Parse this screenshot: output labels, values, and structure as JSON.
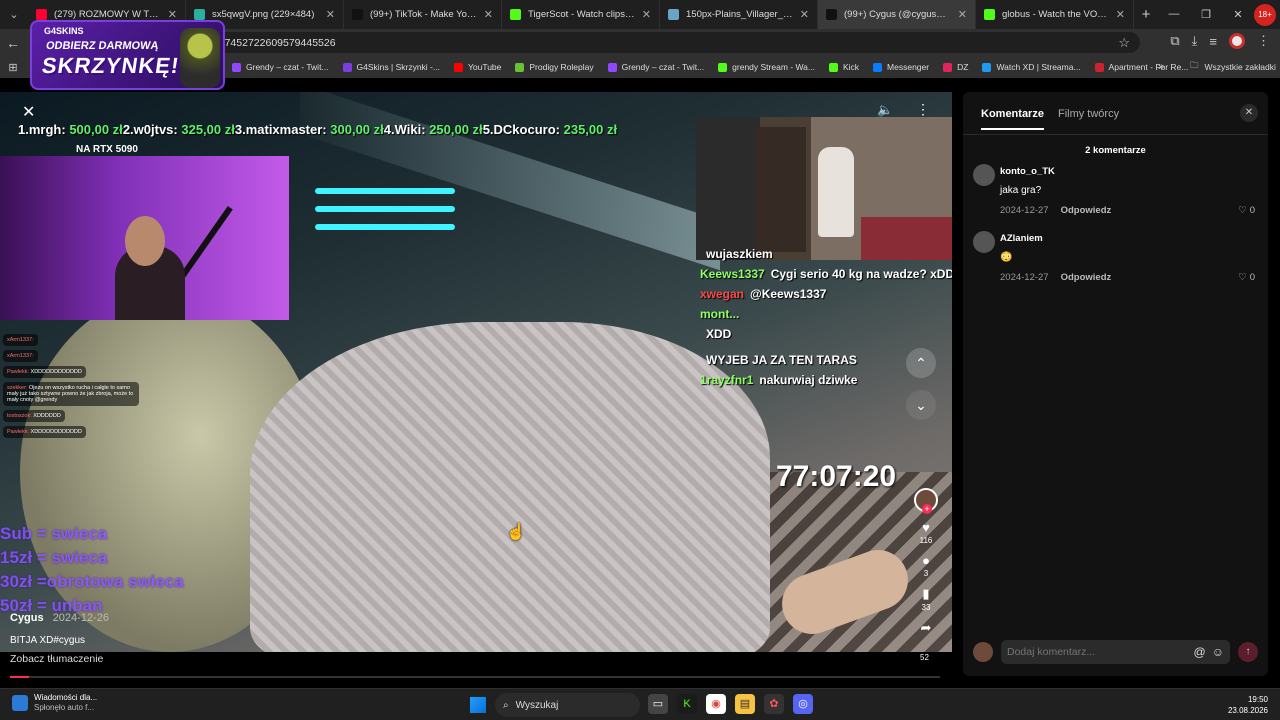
{
  "tabs": [
    {
      "title": "(279) ROZMOWY W TOKU ODCINEK",
      "color": "#ff0033"
    },
    {
      "title": "sx5qwgV.png (229×484)",
      "color": "#2bb0a0"
    },
    {
      "title": "(99+) TikTok - Make Your Day",
      "color": "#111111"
    },
    {
      "title": "TigerScot - Watch clips on Kick",
      "color": "#53fc18"
    },
    {
      "title": "150px-Plains_Villager_Base_JE2",
      "color": "#6aa3c8"
    },
    {
      "title": "(99+) Cygus (@cygus05) | TikTok",
      "color": "#111111",
      "active": true
    },
    {
      "title": "globus - Watch the VOD on Kick",
      "color": "#53fc18"
    }
  ],
  "address": {
    "url": "eo/7452722609579445526"
  },
  "bookmarks": [
    {
      "label": "Grendy – czat - Twit...",
      "color": "#9146ff"
    },
    {
      "label": "G4Skins | Skrzynki -...",
      "color": "#7b3fe0"
    },
    {
      "label": "YouTube",
      "color": "#ff0000"
    },
    {
      "label": "Prodigy Roleplay",
      "color": "#67c23a"
    },
    {
      "label": "Grendy – czat - Twit...",
      "color": "#9146ff"
    },
    {
      "label": "grendy Stream - Wa...",
      "color": "#53fc18"
    },
    {
      "label": "Kick",
      "color": "#53fc18"
    },
    {
      "label": "Messenger",
      "color": "#0a7cff"
    },
    {
      "label": "DZ",
      "color": "#e0245e"
    },
    {
      "label": "Watch XD | Streama...",
      "color": "#1d9bf0"
    },
    {
      "label": "Apartment - For Re...",
      "color": "#cc2233"
    }
  ],
  "bookmarks_all": "Wszystkie zakładki",
  "ad": {
    "brand": "G4SKINS",
    "line1": "ODBIERZ DARMOWĄ",
    "line2": "SKRZYNKĘ!"
  },
  "video": {
    "donors": [
      {
        "rank": "1.",
        "name": "mrgh:",
        "amount": "500,00 zł"
      },
      {
        "rank": "2.",
        "name": "w0jtvs:",
        "amount": "325,00 zł"
      },
      {
        "rank": "3.",
        "name": "matixmaster:",
        "amount": "300,00 zł"
      },
      {
        "rank": "4.",
        "name": "Wiki:",
        "amount": "250,00 zł"
      },
      {
        "rank": "5.",
        "name": "DCkocuro:",
        "amount": "235,00 zł"
      }
    ],
    "donor_sub": "NA RTX 5090",
    "left_chat": [
      {
        "name": "xArm1337:",
        "text": ""
      },
      {
        "name": "xArm1337:",
        "text": ""
      },
      {
        "name": "Pawlekk:",
        "text": "XDDDDDDDDDDDD"
      },
      {
        "name": "szekker:",
        "text": "Ojezu on wszystko rucha i całgle to samo mały już tako sztywne powno że jak zbroja, może to mały cnoty @grendy"
      },
      {
        "name": "tostoszok:",
        "text": "XDDDDDD"
      },
      {
        "name": "Pawlekk:",
        "text": "XDDDDDDDDDDDD"
      }
    ],
    "price_list": [
      "Sub = swieca",
      "15zł = swieca",
      "30zł =obrotowa swieca",
      "50zł = unban"
    ],
    "right_chat": [
      {
        "name": "",
        "text": "wujaszkiem",
        "red": false
      },
      {
        "name": "Keews1337",
        "text": "Cygi serio 40 kg na wadze? xDDD",
        "red": false
      },
      {
        "name": "xwegan",
        "text": "@Keews1337",
        "red": true
      },
      {
        "name": "mont...",
        "text": "",
        "red": false
      },
      {
        "name": "",
        "text": "XDD",
        "red": true
      },
      {
        "name": "",
        "text": "",
        "red": true
      },
      {
        "name": "",
        "text": "WYJEB JA ZA TEN TARAS",
        "red": true
      },
      {
        "name": "1rayzfnr1",
        "text": "nakurwiaj dziwke",
        "red": false
      }
    ],
    "timer": "77:07:20",
    "actions": {
      "likes": "116",
      "comments": "3",
      "saves": "33",
      "shares": "52"
    },
    "progress": 0.02,
    "author": "Cygus",
    "date": "2024-12-26",
    "description": "BITJA XD#cygus",
    "translate": "Zobacz tłumaczenie"
  },
  "comments_panel": {
    "tab_comments": "Komentarze",
    "tab_creator": "Filmy twórcy",
    "count": "2 komentarze",
    "comments": [
      {
        "user": "konto_o_TK",
        "text": "jaka gra?",
        "date": "2024-12-27",
        "reply": "Odpowiedz",
        "likes": "0"
      },
      {
        "user": "AZlaniem",
        "text": "😳",
        "date": "2024-12-27",
        "reply": "Odpowiedz",
        "likes": "0"
      }
    ],
    "input_placeholder": "Dodaj komentarz..."
  },
  "taskbar": {
    "news_title": "Wiadomości dla...",
    "news_sub": "Spłonęło auto f...",
    "search": "Wyszukaj",
    "time": "19:50",
    "date": "23.08.2026"
  }
}
